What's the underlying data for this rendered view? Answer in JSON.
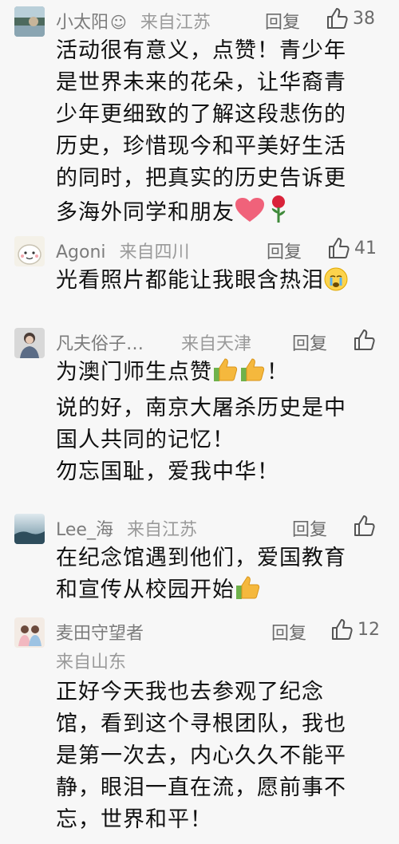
{
  "comments": [
    {
      "name": "小太阳",
      "badge": "😊",
      "location": "来自江苏",
      "reply": "回复",
      "likes": "38",
      "lines": [
        "活动很有意义，点赞！青少年",
        "是世界未来的花朵，让华裔青",
        "少年更细致的了解这段悲伤的",
        "历史，珍惜现今和平美好生活",
        "的同时，把真实的历史告诉更",
        "多海外同学和朋友"
      ],
      "tail_emojis": [
        "heart",
        "rose"
      ]
    },
    {
      "name": "Agoni",
      "location": "来自四川",
      "reply": "回复",
      "likes": "41",
      "lines": [
        "光看照片都能让我眼含热泪"
      ],
      "tail_emojis": [
        "crying-face"
      ]
    },
    {
      "name": "凡夫俗子…",
      "location": "来自天津",
      "reply": "回复",
      "likes": "",
      "lines": [
        "为澳门师生点赞",
        "说的好，南京大屠杀历史是中",
        "国人共同的记忆！",
        "勿忘国耻，爱我中华！"
      ],
      "line1_suffix": "！"
    },
    {
      "name": "Lee_海",
      "location": "来自江苏",
      "reply": "回复",
      "likes": "",
      "lines": [
        "在纪念馆遇到他们，爱国教育",
        "和宣传从校园开始"
      ]
    },
    {
      "name": "麦田守望者",
      "location": "来自山东",
      "reply": "回复",
      "likes": "12",
      "lines": [
        "正好今天我也去参观了纪念",
        "馆，看到这个寻根团队，我也",
        "是第一次去，内心久久不能平",
        "静，眼泪一直在流，愿前事不",
        "忘，世界和平！"
      ]
    }
  ],
  "colors": {
    "text": "#111111",
    "meta": "#7c7c7c",
    "background": "#f7f7f7"
  },
  "icons": [
    "thumbs-up-outline-icon",
    "heart-emoji",
    "rose-emoji",
    "crying-face-emoji",
    "thumbs-up-emoji"
  ]
}
